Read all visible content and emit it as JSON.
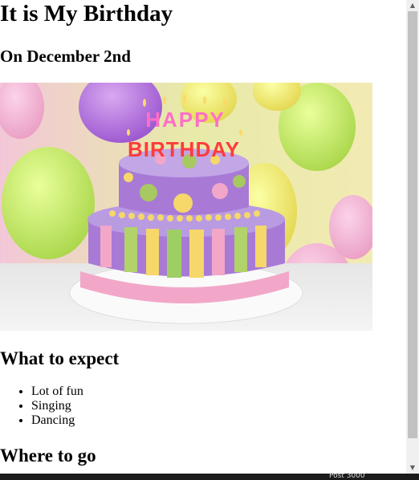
{
  "page": {
    "title": "It is My Birthday",
    "subtitle": "On December 2nd",
    "image_alt": "Birthday cake with Happy Birthday candles",
    "cake_candles_top": "HAPPY",
    "cake_candles_bottom": "BIRTHDAY",
    "expect_heading": "What to expect",
    "expect_items": [
      "Lot of fun",
      "Singing",
      "Dancing"
    ],
    "where_heading": "Where to go"
  },
  "taskbar": {
    "status_text": "Post 3000"
  }
}
